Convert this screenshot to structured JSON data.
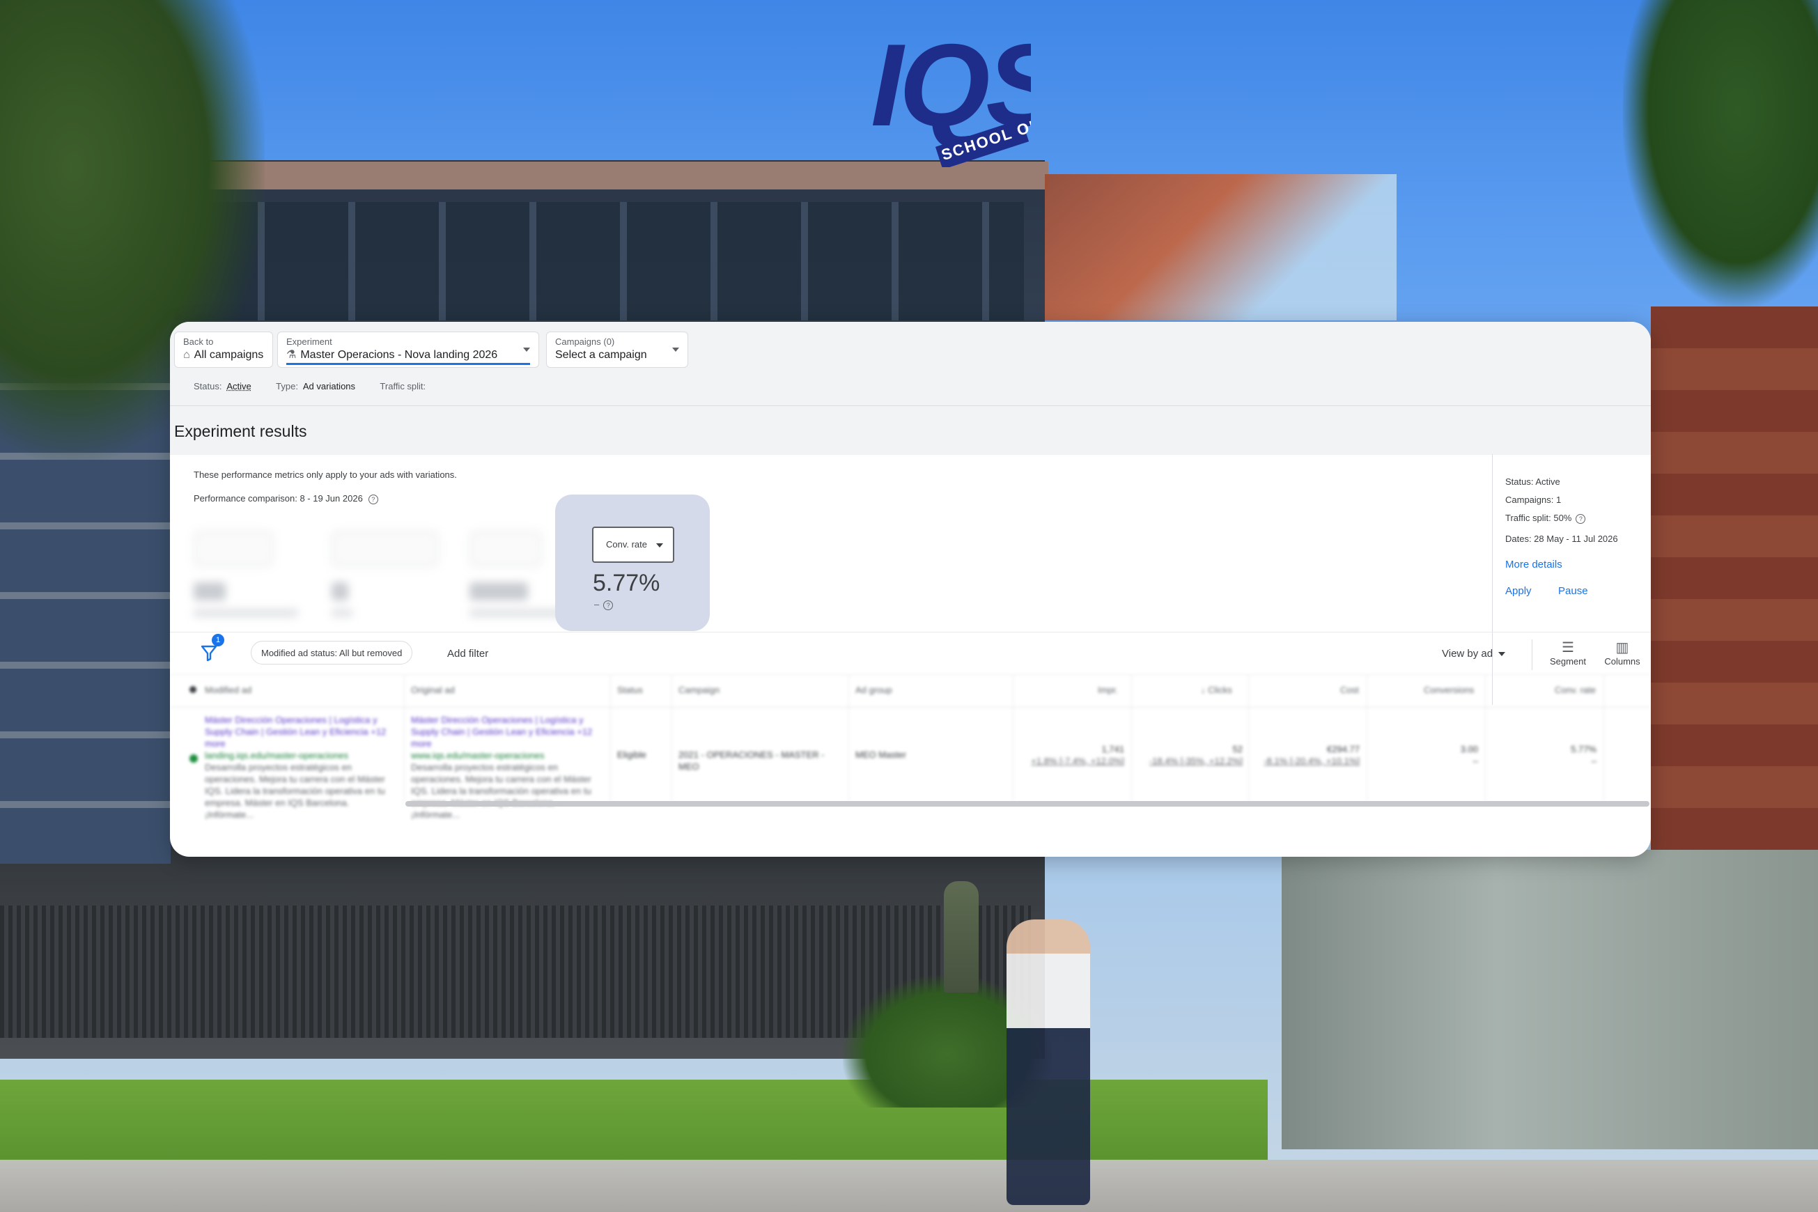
{
  "background": {
    "building_sign": "IQS",
    "building_sign_sub": "SCHOOL OF MANAGEMENT · RAMON LLULL"
  },
  "header": {
    "back": {
      "label": "Back to",
      "value": "All campaigns",
      "icon": "home-icon"
    },
    "experiment": {
      "label": "Experiment",
      "value": "Master Operacions - Nova landing 2026",
      "icon": "flask-icon"
    },
    "campaigns": {
      "label": "Campaigns (0)",
      "value": "Select a campaign"
    },
    "status_label": "Status:",
    "status_value": "Active",
    "type_label": "Type:",
    "type_value": "Ad variations",
    "traffic_label": "Traffic split:",
    "traffic_value": ""
  },
  "results": {
    "title": "Experiment results",
    "note": "These performance metrics only apply to your ads with variations.",
    "comparison": "Performance comparison:  8 - 19 Jun 2026",
    "selected_metric": {
      "label": "Conv. rate",
      "value": "5.77%",
      "sub": "–"
    }
  },
  "side": {
    "status": "Status: Active",
    "campaigns": "Campaigns: 1",
    "traffic": "Traffic split: 50%",
    "dates": "Dates: 28 May - 11 Jul 2026",
    "more_details": "More details",
    "apply": "Apply",
    "pause": "Pause"
  },
  "filters": {
    "badge": "1",
    "chip": "Modified ad status: All but removed",
    "add_filter": "Add filter",
    "view_by": "View by ad",
    "segment": "Segment",
    "columns": "Columns"
  },
  "table": {
    "headers": [
      "Modified ad",
      "Original ad",
      "Status",
      "Campaign",
      "Ad group",
      "Impr.",
      "↓ Clicks",
      "Cost",
      "Conversions",
      "Conv. rate"
    ],
    "row": {
      "modified_title": "Máster Dirección Operaciones | Logística y Supply Chain | Gestión Lean y Eficiencia  +12 more",
      "modified_url": "landing.iqs.edu/master-operaciones",
      "modified_desc": "Desarrolla proyectos estratégicos en operaciones. Mejora tu carrera con el Máster IQS. Lidera la transformación operativa en tu empresa. Máster en IQS Barcelona. ¡Infórmate...",
      "original_title": "Máster Dirección Operaciones | Logística y Supply Chain | Gestión Lean y Eficiencia  +12 more",
      "original_url": "www.iqs.edu/master-operaciones",
      "original_desc": "Desarrolla proyectos estratégicos en operaciones. Mejora tu carrera con el Máster IQS. Lidera la transformación operativa en tu empresa. Máster en IQS Barcelona. ¡Infórmate...",
      "status": "Eligible",
      "campaign": "2021 - OPERACIONES - MASTER - MEO",
      "ad_group": "MEO Master",
      "impr": "1,741",
      "impr_sub": "+1.8% [-7.4%, +12.0%]",
      "clicks": "52",
      "clicks_sub": "-18.4% [-35%, +12.2%]",
      "cost": "€294.77",
      "cost_sub": "-8.1% [-20.4%, +10.1%]",
      "conversions": "3.00",
      "conversions_sub": "–",
      "conv_rate": "5.77%",
      "conv_rate_sub": "–"
    }
  }
}
